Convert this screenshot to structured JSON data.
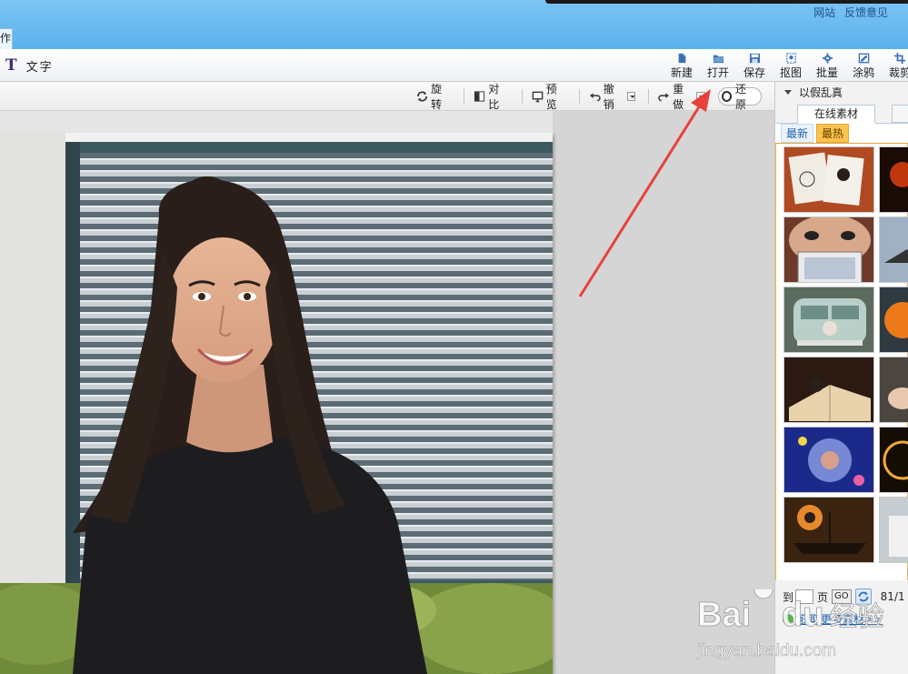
{
  "titlebar": {
    "left_tab_label": "作",
    "links": [
      "网站",
      "反馈意见"
    ]
  },
  "mainbar": {
    "text_tool_label": "文字",
    "tools": [
      {
        "label": "新建",
        "icon": "new-file-icon"
      },
      {
        "label": "打开",
        "icon": "open-folder-icon"
      },
      {
        "label": "保存",
        "icon": "save-disk-icon"
      },
      {
        "label": "抠图",
        "icon": "cutout-icon"
      },
      {
        "label": "批量",
        "icon": "batch-gear-icon"
      },
      {
        "label": "涂鸦",
        "icon": "doodle-icon"
      },
      {
        "label": "裁剪",
        "icon": "crop-icon"
      }
    ]
  },
  "editbar": {
    "rotate": "旋转",
    "compare": "对比",
    "preview": "预览",
    "undo": "撤销",
    "redo": "重做",
    "restore": "还原"
  },
  "rpanel": {
    "section_title": "以假乱真",
    "tab_online": "在线素材",
    "sub_newest": "最新",
    "sub_hottest": "最热",
    "pager_prefix": "到",
    "pager_page": "页",
    "pager_go": "GO",
    "pager_count": "81/1",
    "more_link": "获取更多素材>>"
  },
  "watermark": {
    "brand": "Baidu",
    "brand_cn": "经验",
    "url": "jingyan.baidu.com"
  },
  "colors": {
    "titlebar": "#6fbdf1",
    "accent_orange": "#f9c34d",
    "arrow_red": "#e8413c"
  }
}
